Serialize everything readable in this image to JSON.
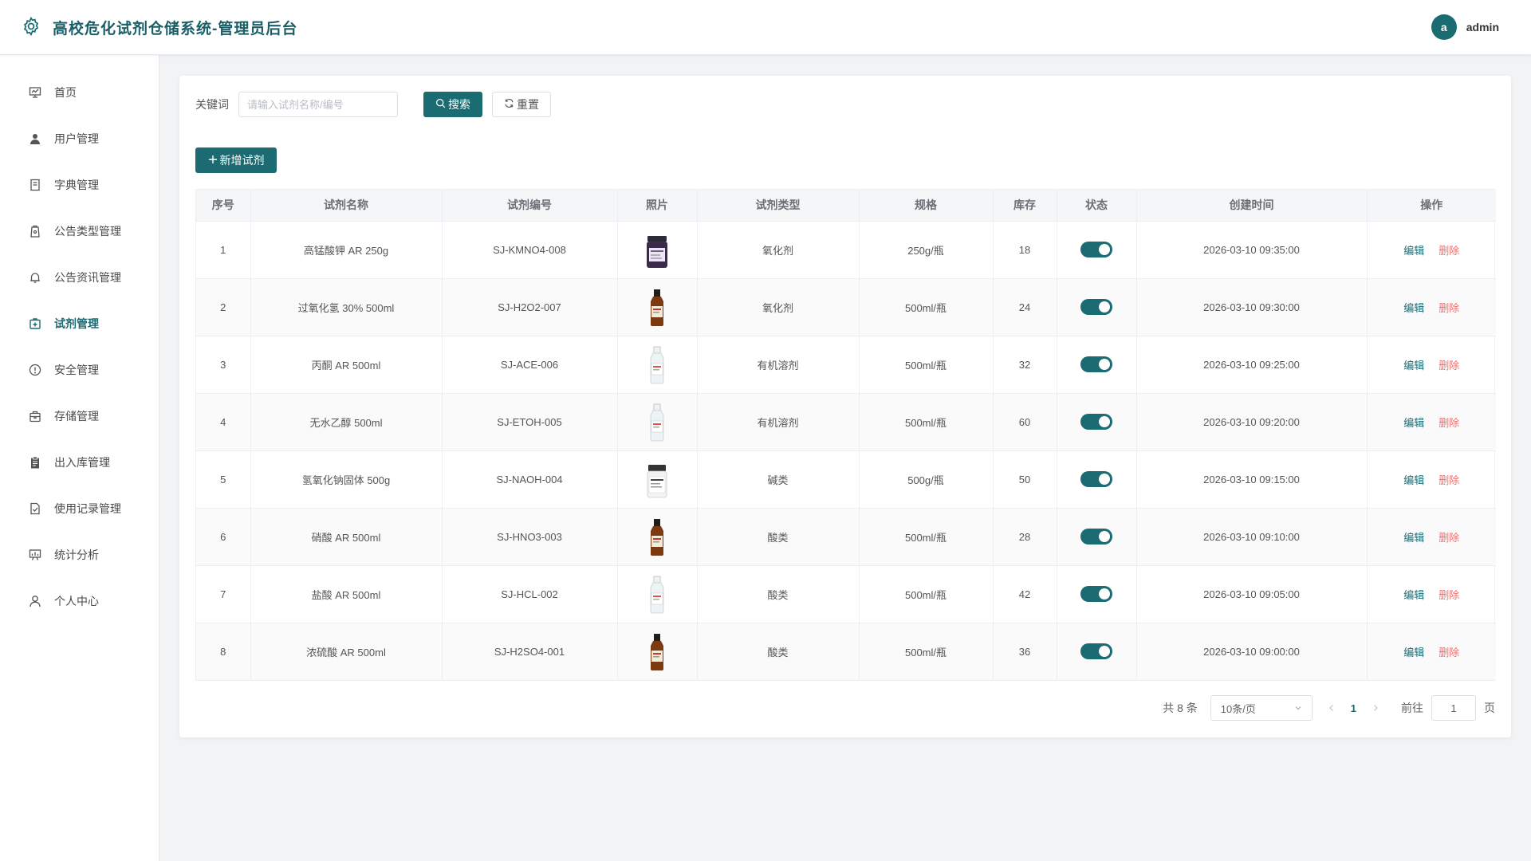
{
  "header": {
    "title": "高校危化试剂仓储系统-管理员后台",
    "avatar_letter": "a",
    "username": "admin",
    "brand_color": "#1a6b72"
  },
  "sidebar": {
    "items": [
      {
        "label": "首页",
        "icon": "dashboard-icon"
      },
      {
        "label": "用户管理",
        "icon": "user-icon"
      },
      {
        "label": "字典管理",
        "icon": "dictionary-icon"
      },
      {
        "label": "公告类型管理",
        "icon": "notice-type-icon"
      },
      {
        "label": "公告资讯管理",
        "icon": "bell-icon"
      },
      {
        "label": "试剂管理",
        "icon": "reagent-icon",
        "active": true
      },
      {
        "label": "安全管理",
        "icon": "warning-icon"
      },
      {
        "label": "存储管理",
        "icon": "storage-icon"
      },
      {
        "label": "出入库管理",
        "icon": "clipboard-icon"
      },
      {
        "label": "使用记录管理",
        "icon": "record-icon"
      },
      {
        "label": "统计分析",
        "icon": "chart-icon"
      },
      {
        "label": "个人中心",
        "icon": "profile-icon"
      }
    ]
  },
  "search": {
    "label": "关键词",
    "placeholder": "请输入试剂名称/编号",
    "value": "",
    "search_button": "搜索",
    "reset_button": "重置"
  },
  "toolbar": {
    "add_button": "新增试剂"
  },
  "table": {
    "columns": [
      "序号",
      "试剂名称",
      "试剂编号",
      "照片",
      "试剂类型",
      "规格",
      "库存",
      "状态",
      "创建时间",
      "操作"
    ],
    "edit_label": "编辑",
    "delete_label": "删除",
    "rows": [
      {
        "index": "1",
        "name": "高锰酸钾 AR 250g",
        "code": "SJ-KMNO4-008",
        "photo": "jar-dark",
        "type": "氧化剂",
        "spec": "250g/瓶",
        "stock": "18",
        "status": true,
        "created": "2026-03-10 09:35:00"
      },
      {
        "index": "2",
        "name": "过氧化氢 30% 500ml",
        "code": "SJ-H2O2-007",
        "photo": "bottle-brown",
        "type": "氧化剂",
        "spec": "500ml/瓶",
        "stock": "24",
        "status": true,
        "created": "2026-03-10 09:30:00"
      },
      {
        "index": "3",
        "name": "丙酮 AR 500ml",
        "code": "SJ-ACE-006",
        "photo": "bottle-clear",
        "type": "有机溶剂",
        "spec": "500ml/瓶",
        "stock": "32",
        "status": true,
        "created": "2026-03-10 09:25:00"
      },
      {
        "index": "4",
        "name": "无水乙醇 500ml",
        "code": "SJ-ETOH-005",
        "photo": "bottle-clear",
        "type": "有机溶剂",
        "spec": "500ml/瓶",
        "stock": "60",
        "status": true,
        "created": "2026-03-10 09:20:00"
      },
      {
        "index": "5",
        "name": "氢氧化钠固体 500g",
        "code": "SJ-NAOH-004",
        "photo": "jar-white",
        "type": "碱类",
        "spec": "500g/瓶",
        "stock": "50",
        "status": true,
        "created": "2026-03-10 09:15:00"
      },
      {
        "index": "6",
        "name": "硝酸 AR 500ml",
        "code": "SJ-HNO3-003",
        "photo": "bottle-brown",
        "type": "酸类",
        "spec": "500ml/瓶",
        "stock": "28",
        "status": true,
        "created": "2026-03-10 09:10:00"
      },
      {
        "index": "7",
        "name": "盐酸 AR 500ml",
        "code": "SJ-HCL-002",
        "photo": "bottle-clear",
        "type": "酸类",
        "spec": "500ml/瓶",
        "stock": "42",
        "status": true,
        "created": "2026-03-10 09:05:00"
      },
      {
        "index": "8",
        "name": "浓硫酸 AR 500ml",
        "code": "SJ-H2SO4-001",
        "photo": "bottle-brown",
        "type": "酸类",
        "spec": "500ml/瓶",
        "stock": "36",
        "status": true,
        "created": "2026-03-10 09:00:00"
      }
    ]
  },
  "pagination": {
    "total_text": "共 8 条",
    "page_size": "10条/页",
    "current_page": "1",
    "goto_label": "前往",
    "goto_value": "1",
    "page_suffix": "页"
  }
}
